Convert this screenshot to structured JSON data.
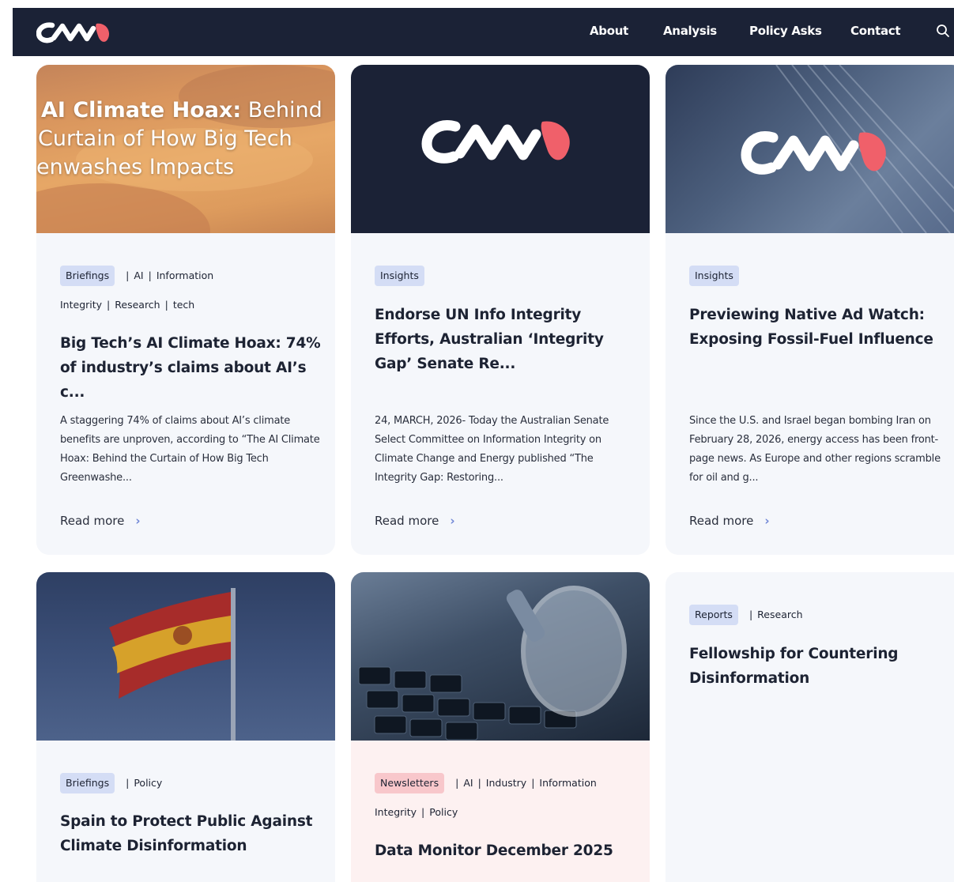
{
  "nav": {
    "links": [
      "About",
      "Analysis",
      "Policy Asks",
      "Contact"
    ]
  },
  "cards": [
    {
      "hero_lines": [
        "AI Climate Hoax: Behind",
        "Curtain of How Big Tech",
        "enwashes Impacts"
      ],
      "hero_bold": "AI Climate Hoax:",
      "badge": "Briefings",
      "tags_line1": [
        "AI",
        "Information"
      ],
      "tags_line2": [
        "Integrity",
        "Research",
        "tech"
      ],
      "title": "Big Tech’s AI Climate Hoax: 74% of industry’s claims about AI’s c...",
      "excerpt": "A staggering 74% of claims about AI’s climate benefits are unproven, according to “The AI Climate Hoax: Behind the Curtain of How Big Tech Greenwashe...",
      "read_more": "Read more"
    },
    {
      "badge": "Insights",
      "title": "Endorse UN Info Integrity Efforts, Australian ‘Integrity Gap’ Senate Re...",
      "excerpt": "24, MARCH, 2026- Today the Australian Senate Select Committee on Information Integrity on Climate Change and Energy published “The Integrity Gap: Restoring...",
      "read_more": "Read more"
    },
    {
      "badge": "Insights",
      "title": "Previewing Native Ad Watch: Exposing Fossil-Fuel Influence",
      "excerpt": "Since the U.S. and Israel began bombing Iran on February 28, 2026, energy access has been front-page news. As Europe and other regions scramble for oil and g...",
      "read_more": "Read more"
    },
    {
      "badge": "Briefings",
      "tags_line1": [
        "Policy"
      ],
      "title": "Spain to Protect Public Against Climate Disinformation"
    },
    {
      "badge": "Newsletters",
      "tags_line1": [
        "AI",
        "Industry",
        "Information"
      ],
      "tags_line2": [
        "Integrity",
        "Policy"
      ],
      "title": "Data Monitor December 2025"
    },
    {
      "badge": "Reports",
      "tags_line1": [
        "Research"
      ],
      "title": "Fellowship for Countering Disinformation"
    }
  ],
  "colors": {
    "nav_bg": "#1b2236",
    "card_bg": "#f5f7fb",
    "badge_blue": "#d4ddf5",
    "badge_pink": "#f8c7cb",
    "logo_accent": "#f0606a"
  }
}
